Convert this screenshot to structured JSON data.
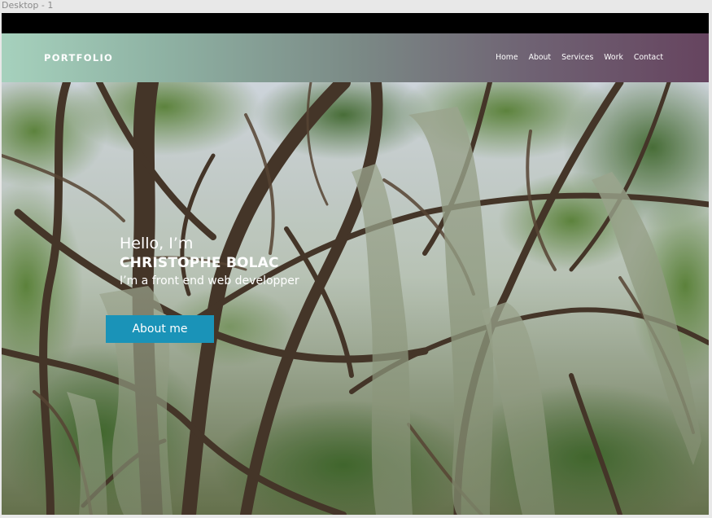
{
  "window": {
    "frame_label": "Desktop - 1"
  },
  "header": {
    "logo": "PORTFOLIO",
    "nav": [
      "Home",
      "About",
      "Services",
      "Work",
      "Contact"
    ]
  },
  "hero": {
    "greeting": "Hello, I’m",
    "name": "CHRISTOPHE BOLAC",
    "tagline": "I’m a front end web developper",
    "cta_label": "About me",
    "background_image": "trees-with-spanish-moss"
  },
  "colors": {
    "nav_gradient_start": "#a6d1bd",
    "nav_gradient_end": "#66445f",
    "cta_background": "#1a93b8"
  }
}
